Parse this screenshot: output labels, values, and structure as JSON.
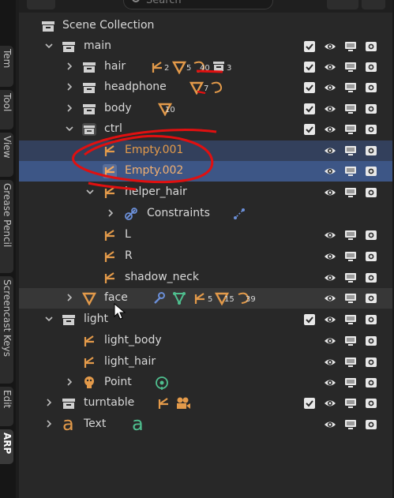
{
  "tabs": [
    {
      "label": "Tem"
    },
    {
      "label": "Tool"
    },
    {
      "label": "View"
    },
    {
      "label": "Grease Pencil"
    },
    {
      "label": "Screencast Keys"
    },
    {
      "label": "Edit"
    },
    {
      "label": "ARP"
    }
  ],
  "header": {
    "search_placeholder": "Search"
  },
  "outliner": {
    "scene_collection": "Scene Collection",
    "main": "main",
    "hair": "hair",
    "hair_counts": {
      "a": "2",
      "b": "5",
      "c": "40",
      "d": "3"
    },
    "headphone": "headphone",
    "headphone_count": "7",
    "body": "body",
    "body_count": "10",
    "ctrl": "ctrl",
    "empty001": "Empty.001",
    "empty002": "Empty.002",
    "helper_hair": "helper_hair",
    "constraints": "Constraints",
    "L": "L",
    "R": "R",
    "shadow_neck": "shadow_neck",
    "face": "face",
    "face_counts": {
      "a": "5",
      "b": "15",
      "c": "39"
    },
    "light": "light",
    "light_body": "light_body",
    "light_hair": "light_hair",
    "point": "Point",
    "turntable": "turntable",
    "text": "Text"
  },
  "colors": {
    "selected_row": "#33405c",
    "active_row": "#3d5686",
    "empty_orange": "#e39a4a",
    "mesh_orange": "#e39a4a",
    "constraint_blue": "#6b8fd8",
    "modifier_blue": "#6b8fd8",
    "green": "#4fbf8f",
    "annotation_red": "#e01010"
  }
}
